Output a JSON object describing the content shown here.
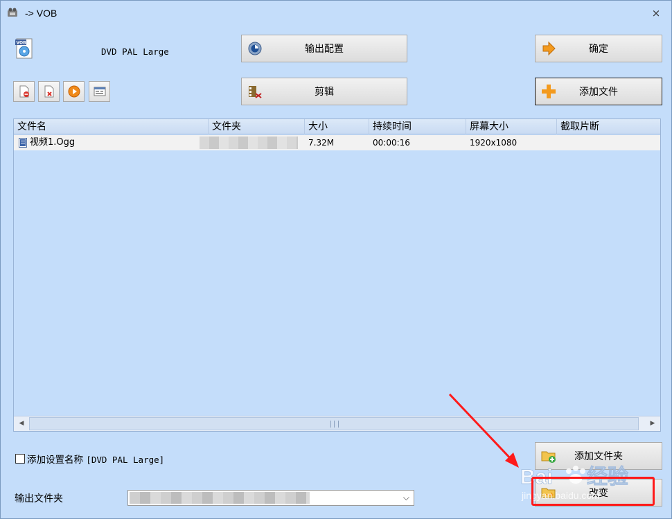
{
  "window": {
    "title": "-> VOB",
    "close_label": "×"
  },
  "profile": {
    "name": "DVD PAL Large"
  },
  "buttons": {
    "output_config": "输出配置",
    "edit": "剪辑",
    "confirm": "确定",
    "add_file": "添加文件",
    "add_folder": "添加文件夹",
    "change": "改变"
  },
  "table": {
    "columns": [
      "文件名",
      "文件夹",
      "大小",
      "持续时间",
      "屏幕大小",
      "截取片断"
    ],
    "rows": [
      {
        "name": "视频1.Ogg",
        "folder": "",
        "size": "7.32M",
        "duration": "00:00:16",
        "screen": "1920x1080",
        "clip": ""
      }
    ]
  },
  "options": {
    "add_setting_name_label": "添加设置名称",
    "add_setting_name_value": "[DVD PAL Large]",
    "checked": false
  },
  "output": {
    "label": "输出文件夹",
    "dropdown_glyph": "⌵"
  },
  "watermark": {
    "text": "jingyan.baidu.com"
  },
  "colors": {
    "accent_orange": "#f39a1e",
    "annotation_red": "#ff1a1a"
  }
}
